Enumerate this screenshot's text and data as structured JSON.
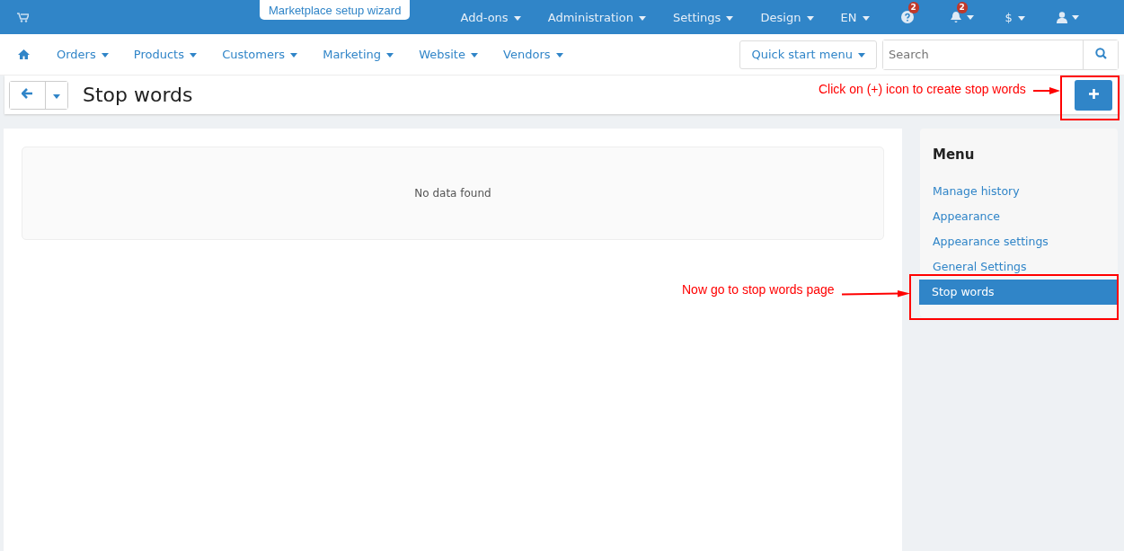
{
  "top_bar": {
    "wizard_button": "Marketplace setup wizard",
    "menus": [
      {
        "kind": "text",
        "label": "Add-ons"
      },
      {
        "kind": "text",
        "label": "Administration"
      },
      {
        "kind": "text",
        "label": "Settings"
      },
      {
        "kind": "text",
        "label": "Design"
      },
      {
        "kind": "text",
        "label": "EN"
      },
      {
        "kind": "help",
        "badge": "2"
      },
      {
        "kind": "bell",
        "badge": "2"
      },
      {
        "kind": "text",
        "label": "$"
      },
      {
        "kind": "user"
      }
    ]
  },
  "nav": {
    "items": [
      "Orders",
      "Products",
      "Customers",
      "Marketing",
      "Website",
      "Vendors"
    ],
    "quick_start": "Quick start menu",
    "search": {
      "placeholder": "Search"
    }
  },
  "page": {
    "title": "Stop words",
    "empty_message": "No data found"
  },
  "sidebar": {
    "title": "Menu",
    "items": [
      {
        "label": "Manage history",
        "selected": false
      },
      {
        "label": "Appearance",
        "selected": false
      },
      {
        "label": "Appearance settings",
        "selected": false
      },
      {
        "label": "General Settings",
        "selected": false
      },
      {
        "label": "Stop words",
        "selected": true
      }
    ]
  },
  "annotations": [
    {
      "text": "Click on (+) icon to create stop words"
    },
    {
      "text": "Now go to stop words page"
    }
  ]
}
